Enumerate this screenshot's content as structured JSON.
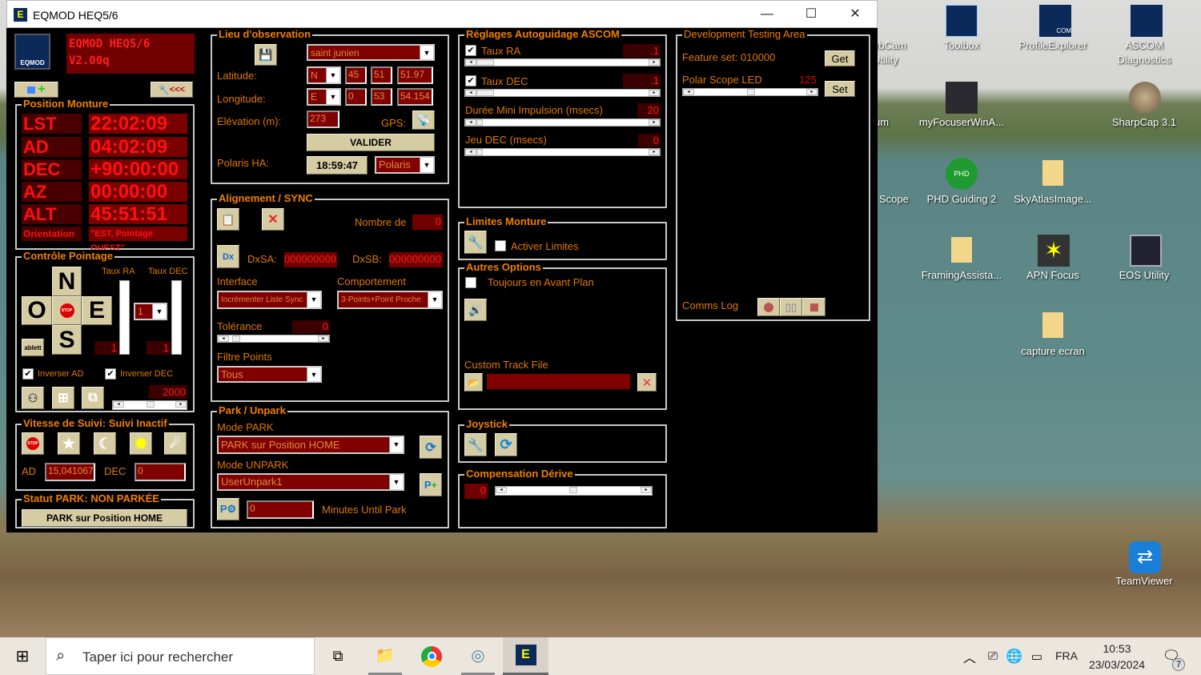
{
  "window": {
    "title": "EQMOD HEQ5/6",
    "min": "—",
    "max": "☐",
    "close": "✕"
  },
  "header": {
    "logo": "EQMOD",
    "title_line1": "EQMOD HEQ5/6",
    "title_line2": "V2.00q",
    "wrench_arrows": "<<<"
  },
  "position": {
    "title": "Position Monture",
    "rows": [
      {
        "label": "LST",
        "value": "22:02:09"
      },
      {
        "label": "AD",
        "value": "04:02:09"
      },
      {
        "label": "DEC",
        "value": "+90:00:00"
      },
      {
        "label": "AZ",
        "value": "00:00:00"
      },
      {
        "label": "ALT",
        "value": "45:51:51"
      }
    ],
    "orientation_label": "Orientation",
    "orientation_value": "\"EST, Pointage OUEST\""
  },
  "slew": {
    "title": "Contrôle Pointage",
    "n": "N",
    "o": "O",
    "e": "E",
    "s": "S",
    "stop": "STOP",
    "tablet": "ablett",
    "rate_ra_label": "Taux RA",
    "rate_dec_label": "Taux DEC",
    "rate_select": "1",
    "rate_ra": "1",
    "rate_dec": "1",
    "invert_ad": "Inverser AD",
    "invert_dec": "Inverser DEC",
    "speed": "2000"
  },
  "tracking": {
    "title": "Vitesse de Suivi: Suivi Inactif",
    "ad_label": "AD",
    "ad_value": "15,041067",
    "dec_label": "DEC",
    "dec_value": "0",
    "stop": "STOP"
  },
  "park_status": {
    "title": "Statut PARK: NON PARKÉE",
    "button": "PARK sur Position HOME"
  },
  "site": {
    "title": "Lieu d'observation",
    "name": "saint junien",
    "lat_label": "Latitude:",
    "lat_ns": "N",
    "lat_d": "45",
    "lat_m": "51",
    "lat_s": "51.97",
    "lon_label": "Longitude:",
    "lon_ew": "E",
    "lon_d": "0",
    "lon_m": "53",
    "lon_s": "54.154",
    "elev_label": "Elévation (m):",
    "elev": "273",
    "gps_label": "GPS:",
    "validate": "VALIDER",
    "polaris_label": "Polaris HA:",
    "polaris_ha": "18:59:47",
    "polaris_star": "Polaris"
  },
  "align": {
    "title": "Alignement / SYNC",
    "count_label": "Nombre de",
    "count": "0",
    "dxsa_label": "DxSA:",
    "dxsa": "000000000",
    "dxsb_label": "DxSB:",
    "dxsb": "000000000",
    "dx": "Dx",
    "interface_label": "Interface",
    "interface": "Incrémenter Liste Sync",
    "behaviour_label": "Comportement",
    "behaviour": "3-Points+Point Proche",
    "tolerance_label": "Tolérance",
    "tolerance": "0",
    "filter_label": "Filtre Points",
    "filter": "Tous"
  },
  "park": {
    "title": "Park / Unpark",
    "mode_park_label": "Mode PARK",
    "mode_park": "PARK sur Position HOME",
    "mode_unpark_label": "Mode UNPARK",
    "mode_unpark": "UserUnpark1",
    "minutes": "0",
    "minutes_label": "Minutes Until Park"
  },
  "guide": {
    "title": "Réglages Autoguidage ASCOM",
    "ra_label": "Taux RA",
    "ra": ".1",
    "dec_label": "Taux DEC",
    "dec": ".1",
    "pulse_label": "Durée Mini Impulsion (msecs)",
    "pulse": "20",
    "backlash_label": "Jeu DEC (msecs)",
    "backlash": "0"
  },
  "limits": {
    "title": "Limites Monture",
    "enable": "Activer Limites"
  },
  "options": {
    "title": "Autres Options",
    "on_top": "Toujours en Avant Plan",
    "track_file_label": "Custom Track File",
    "track_file": ""
  },
  "joystick": {
    "title": "Joystick"
  },
  "drift": {
    "title": "Compensation Dérive",
    "value": "0"
  },
  "dev": {
    "title": "Development Testing Area",
    "feature_label": "Feature set:",
    "feature": "010000",
    "get": "Get",
    "led_label": "Polar Scope LED",
    "led": "125",
    "set": "Set",
    "comms_label": "Comms Log"
  },
  "desktop": {
    "icons": [
      "ebCam",
      "Utility",
      "Toolbox",
      "ProfileExplorer",
      "ASCOM",
      "Diagnostics",
      "um",
      "myFocuserWinA...",
      "SharpCap 3.1",
      "Scope",
      "PHD Guiding 2",
      "SkyAtlasImage...",
      "FramingAssista...",
      "APN Focus",
      "EOS Utility",
      "capture ecran",
      "TeamViewer"
    ],
    "phd": "PHD",
    "com": "COM"
  },
  "taskbar": {
    "search_placeholder": "Taper ici pour rechercher",
    "lang": "FRA",
    "time": "10:53",
    "date": "23/03/2024",
    "notif_count": "7"
  }
}
